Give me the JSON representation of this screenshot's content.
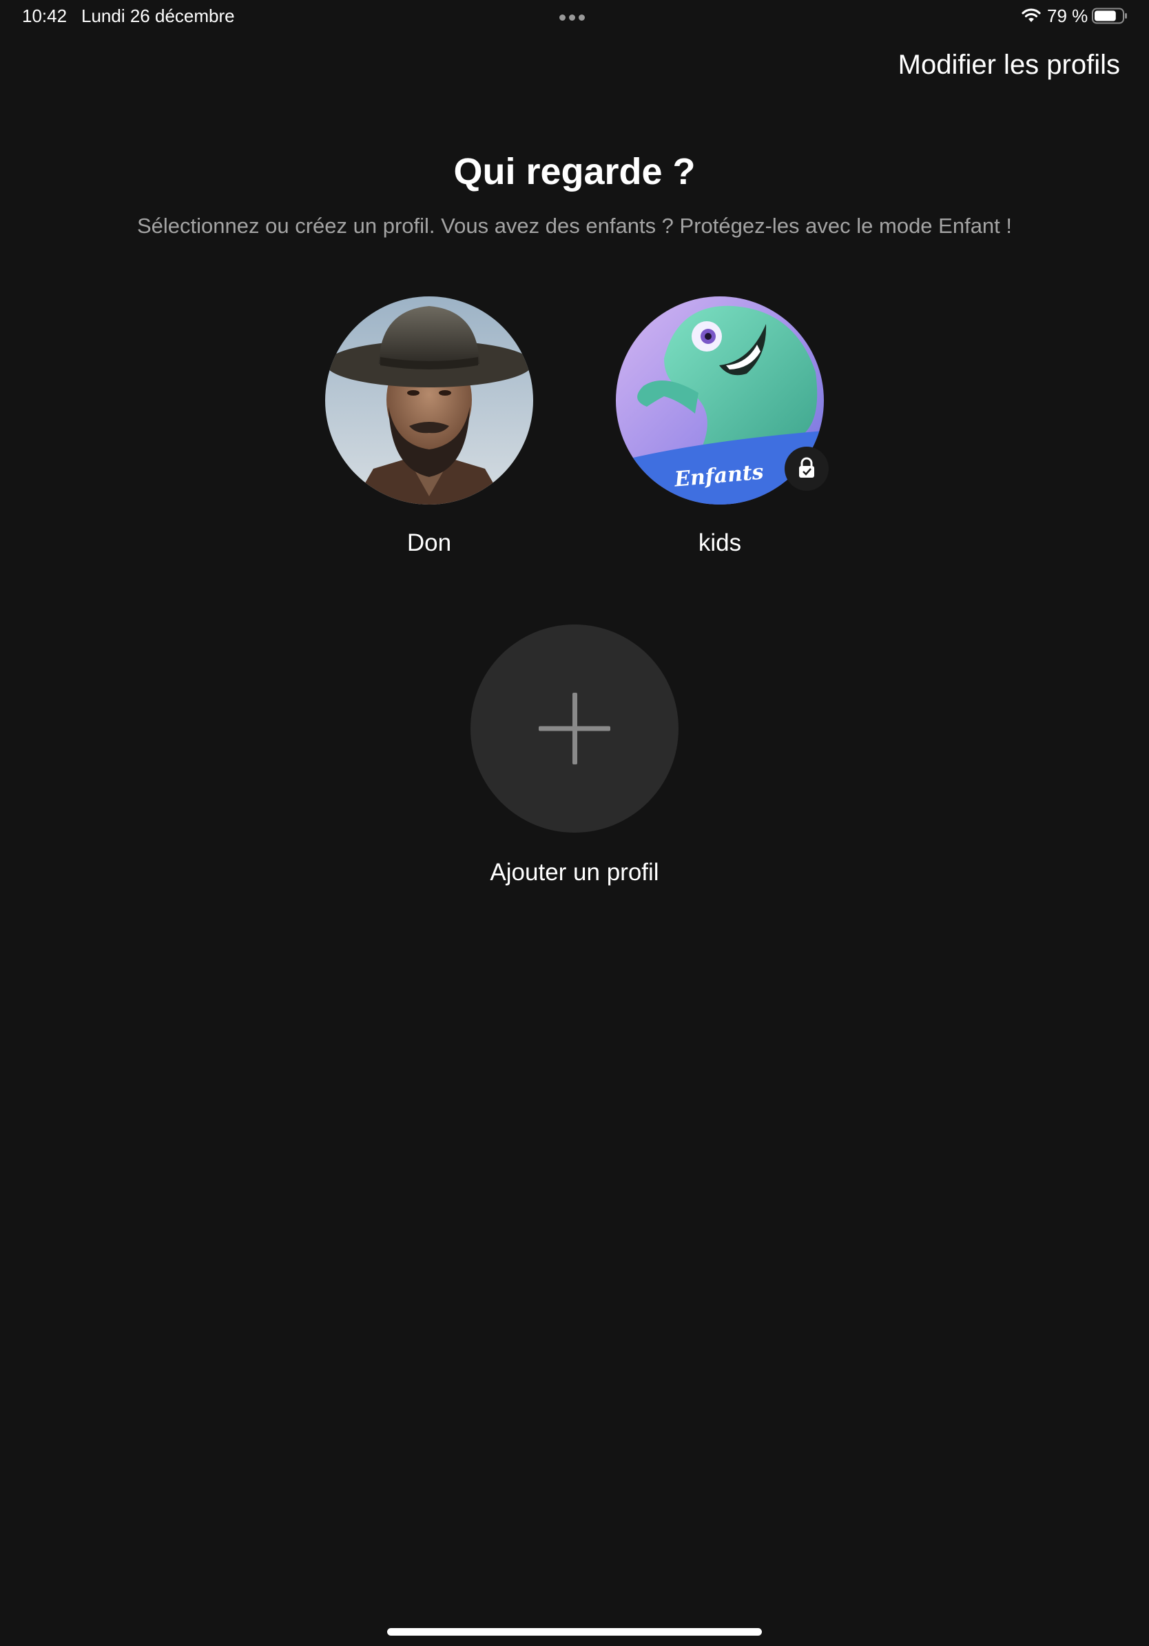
{
  "status_bar": {
    "time": "10:42",
    "date": "Lundi 26 décembre",
    "battery_percent": "79 %",
    "battery_level": 0.79,
    "icons": [
      "multitask-dots-icon",
      "wifi-icon",
      "battery-icon"
    ]
  },
  "header": {
    "edit_profiles_label": "Modifier les profils"
  },
  "main": {
    "title": "Qui regarde ?",
    "subtitle": "Sélectionnez ou créez un profil. Vous avez des enfants ? Protégez-les avec le mode Enfant !",
    "profiles": [
      {
        "name": "Don",
        "avatar": "cowboy-portrait"
      },
      {
        "name": "kids",
        "avatar": "kids-mascot",
        "avatar_text": "Enfants",
        "locked": true,
        "badge_icon": "lock-icon"
      }
    ],
    "add_profile": {
      "label": "Ajouter un profil",
      "icon": "plus-icon"
    }
  },
  "colors": {
    "background": "#131313",
    "subtitle": "#a4a4a4",
    "add_circle": "#2b2b2b",
    "plus": "#8a8a8a"
  }
}
